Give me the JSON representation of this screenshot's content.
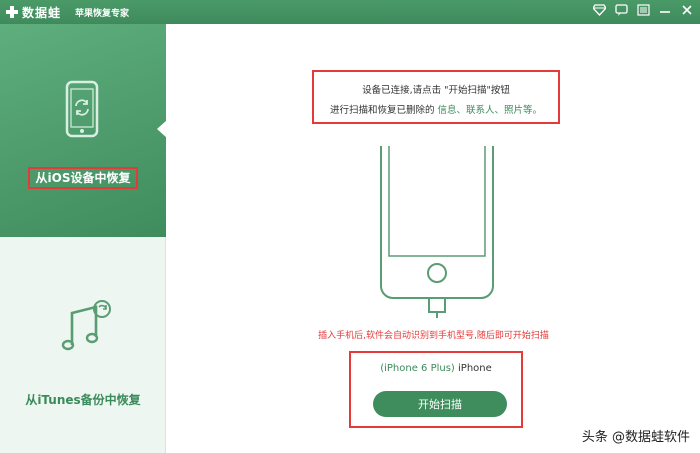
{
  "titlebar": {
    "brand": "数据蛙",
    "subtitle": "苹果恢复专家",
    "controls": [
      "diamond-icon",
      "chat-icon",
      "menu-icon",
      "minimize-icon",
      "close-icon"
    ]
  },
  "sidebar": {
    "items": [
      {
        "label": "从iOS设备中恢复",
        "icon": "phone-icon",
        "active": true
      },
      {
        "label": "从iTunes备份中恢复",
        "icon": "music-icon",
        "active": false
      }
    ]
  },
  "main": {
    "info_line1": "设备已连接,请点击 \"开始扫描\"按钮",
    "info_line2_prefix": "进行扫描和恢复已删除的",
    "info_line2_highlight": "信息、联系人、照片等。",
    "hint": "插入手机后,软件会自动识别到手机型号,随后即可开始扫描",
    "device_model": "(iPhone 6 Plus)",
    "device_type": "iPhone",
    "start_button": "开始扫描"
  },
  "watermark": "头条 @数据蛙软件",
  "colors": {
    "accent": "#3f8c5d",
    "highlight": "#e53a3a"
  }
}
